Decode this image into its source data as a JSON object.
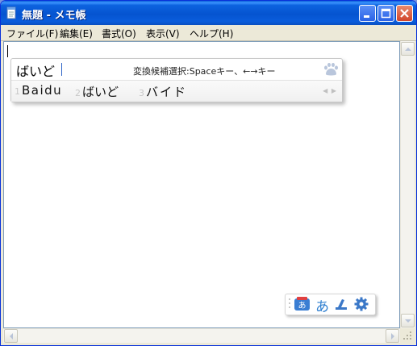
{
  "window": {
    "title": "無題 - メモ帳"
  },
  "menu": {
    "items": [
      {
        "label": "ファイル(F)"
      },
      {
        "label": "編集(E)"
      },
      {
        "label": "書式(O)"
      },
      {
        "label": "表示(V)"
      },
      {
        "label": "ヘルプ(H)"
      }
    ]
  },
  "ime": {
    "composition": "ばいど",
    "hint": "変換候補選択:Spaceキー、←→キー",
    "candidates": [
      {
        "number": "1",
        "text": "Baidu"
      },
      {
        "number": "2",
        "text": "ばいど"
      },
      {
        "number": "3",
        "text": "バイド"
      }
    ],
    "pager": "◀ ▶"
  },
  "toolbar": {
    "mode_label": "あ"
  },
  "colors": {
    "titlebar": "#0554d0",
    "accent": "#2f7fd0",
    "editor_bg": "#ffffff"
  }
}
